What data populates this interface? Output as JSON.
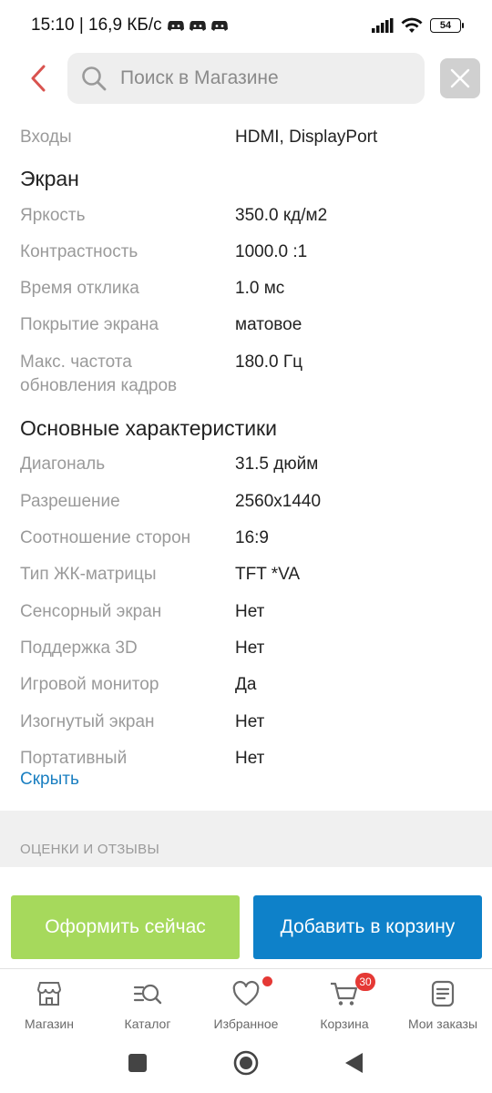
{
  "status_bar": {
    "time_info": "15:10 | 16,9 КБ/с",
    "battery": "54"
  },
  "header": {
    "search_placeholder": "Поиск в Магазине"
  },
  "specs": {
    "top": [
      {
        "label": "Входы",
        "value": "HDMI, DisplayPort"
      }
    ],
    "screen_title": "Экран",
    "screen": [
      {
        "label": "Яркость",
        "value": "350.0 кд/м2"
      },
      {
        "label": "Контрастность",
        "value": "1000.0 :1"
      },
      {
        "label": "Время отклика",
        "value": "1.0 мс"
      },
      {
        "label": "Покрытие экрана",
        "value": "матовое"
      },
      {
        "label": "Макс. частота\nобновления кадров",
        "value": "180.0 Гц"
      }
    ],
    "main_title": "Основные характеристики",
    "main": [
      {
        "label": "Диагональ",
        "value": "31.5 дюйм"
      },
      {
        "label": "Разрешение",
        "value": "2560x1440"
      },
      {
        "label": "Соотношение сторон",
        "value": "16:9"
      },
      {
        "label": "Тип ЖК-матрицы",
        "value": "TFT *VA"
      },
      {
        "label": "Сенсорный экран",
        "value": "Нет"
      },
      {
        "label": "Поддержка 3D",
        "value": "Нет"
      },
      {
        "label": "Игровой монитор",
        "value": "Да"
      },
      {
        "label": "Изогнутый экран",
        "value": "Нет"
      },
      {
        "label": "Портативный",
        "value": "Нет"
      }
    ],
    "hide_link": "Скрыть"
  },
  "reviews": {
    "section_label": "ОЦЕНКИ И ОТЗЫВЫ"
  },
  "actions": {
    "checkout_label": "Оформить сейчас",
    "add_to_cart_label": "Добавить в корзину"
  },
  "bottom_nav": {
    "items": [
      {
        "label": "Магазин",
        "icon": "store-icon"
      },
      {
        "label": "Каталог",
        "icon": "catalog-search-icon"
      },
      {
        "label": "Избранное",
        "icon": "heart-icon"
      },
      {
        "label": "Корзина",
        "icon": "cart-icon"
      },
      {
        "label": "Мои заказы",
        "icon": "orders-icon"
      }
    ],
    "cart_count": "30"
  },
  "colors": {
    "accent_red": "#e53935",
    "checkout_green": "#a6d95c",
    "cart_blue": "#0e81c9",
    "link_blue": "#1a7fc1"
  }
}
